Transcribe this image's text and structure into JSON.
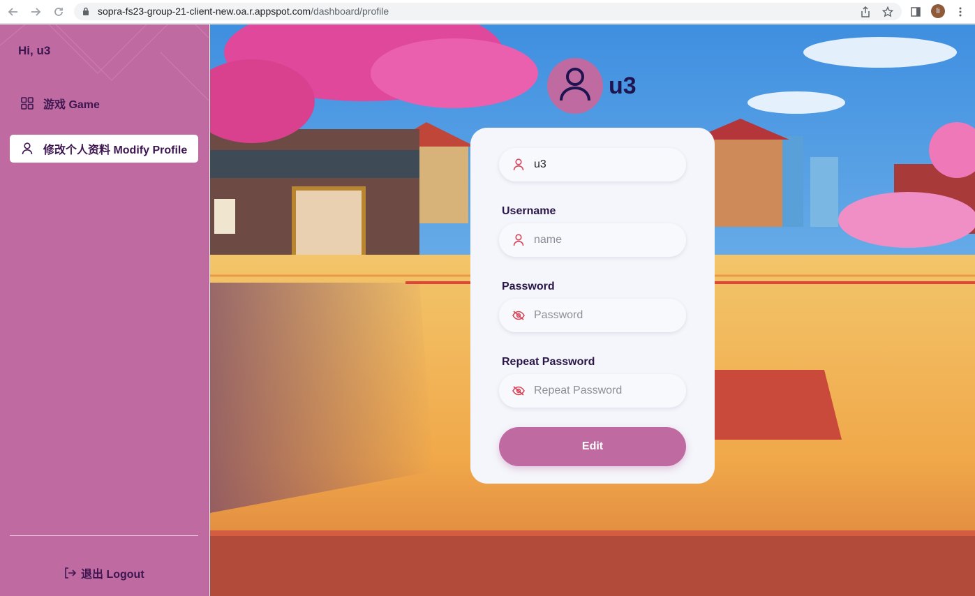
{
  "browser": {
    "url_host": "sopra-fs23-group-21-client-new.oa.r.appspot.com",
    "url_path": "/dashboard/profile",
    "profile_initial": "li"
  },
  "sidebar": {
    "greeting": "Hi, u3",
    "items": [
      {
        "label": "游戏 Game",
        "icon": "grid-icon",
        "active": false
      },
      {
        "label": "修改个人资料 Modify Profile",
        "icon": "user-icon",
        "active": true
      }
    ],
    "logout_label": "退出 Logout"
  },
  "profile": {
    "display_name": "u3",
    "current_username": "u3",
    "username_label": "Username",
    "username_placeholder": "name",
    "password_label": "Password",
    "password_placeholder": "Password",
    "repeat_label": "Repeat Password",
    "repeat_placeholder": "Repeat Password",
    "edit_label": "Edit"
  },
  "colors": {
    "accent": "#bf6ba2",
    "text_dark": "#3d1650",
    "icon_red": "#d6455a"
  }
}
